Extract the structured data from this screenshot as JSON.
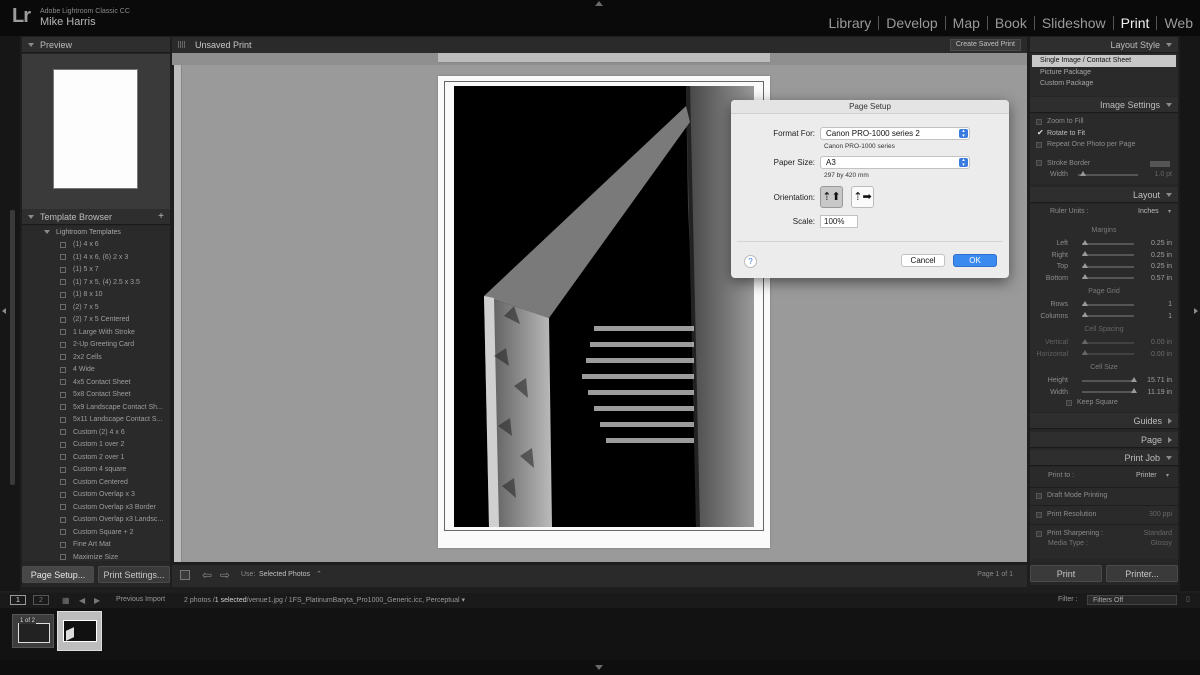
{
  "app": {
    "logo": "Lr",
    "name": "Adobe Lightroom Classic CC",
    "user": "Mike Harris"
  },
  "modules": [
    "Library",
    "Develop",
    "Map",
    "Book",
    "Slideshow",
    "Print",
    "Web"
  ],
  "active_module": "Print",
  "left_panel": {
    "preview_title": "Preview",
    "template_browser_title": "Template Browser",
    "template_browser_add": "+",
    "folder": "Lightroom Templates",
    "templates": [
      "(1) 4 x 6",
      "(1) 4 x 6, (6) 2 x 3",
      "(1) 5 x 7",
      "(1) 7 x 5, (4) 2.5 x 3.5",
      "(1) 8 x 10",
      "(2) 7 x 5",
      "(2) 7 x 5 Centered",
      "1 Large With Stroke",
      "2-Up Greeting Card",
      "2x2 Cells",
      "4 Wide",
      "4x5 Contact Sheet",
      "5x8 Contact Sheet",
      "5x9 Landscape Contact Sh...",
      "5x11 Landscape Contact S...",
      "Custom (2) 4 x 6",
      "Custom 1 over 2",
      "Custom 2 over 1",
      "Custom 4 square",
      "Custom Centered",
      "Custom Overlap x 3",
      "Custom Overlap x3 Border",
      "Custom Overlap x3 Landsc...",
      "Custom Square + 2",
      "Fine Art Mat",
      "Maximize Size"
    ],
    "page_setup_btn": "Page Setup...",
    "print_settings_btn": "Print Settings..."
  },
  "main": {
    "title": "Unsaved Print",
    "create_saved_print": "Create Saved Print",
    "use_label": "Use:",
    "use_value": "Selected Photos",
    "page_indicator": "Page 1 of 1"
  },
  "right_panel": {
    "layout_style_title": "Layout Style",
    "layout_styles": [
      "Single Image / Contact Sheet",
      "Picture Package",
      "Custom Package"
    ],
    "image_settings_title": "Image Settings",
    "zoom_to_fill": "Zoom to Fill",
    "rotate_to_fit": "Rotate to Fit",
    "repeat_one": "Repeat One Photo per Page",
    "stroke_border": "Stroke Border",
    "width_label": "Width",
    "width_value": "1.0 pt",
    "layout_title": "Layout",
    "ruler_units_label": "Ruler Units :",
    "ruler_units_value": "Inches",
    "margins_label": "Margins",
    "margins": [
      {
        "label": "Left",
        "value": "0.25 in"
      },
      {
        "label": "Right",
        "value": "0.25 in"
      },
      {
        "label": "Top",
        "value": "0.25 in"
      },
      {
        "label": "Bottom",
        "value": "0.57 in"
      }
    ],
    "page_grid_label": "Page Grid",
    "grid": [
      {
        "label": "Rows",
        "value": "1"
      },
      {
        "label": "Columns",
        "value": "1"
      }
    ],
    "cell_spacing_label": "Cell Spacing",
    "spacing": [
      {
        "label": "Vertical",
        "value": "0.00 in"
      },
      {
        "label": "Horizontal",
        "value": "0.00 in"
      }
    ],
    "cell_size_label": "Cell Size",
    "cell_size": [
      {
        "label": "Height",
        "value": "15.71 in"
      },
      {
        "label": "Width",
        "value": "11.19 in"
      }
    ],
    "keep_square": "Keep Square",
    "guides_title": "Guides",
    "page_title": "Page",
    "print_job_title": "Print Job",
    "print_to_label": "Print to :",
    "print_to_value": "Printer",
    "draft_mode": "Draft Mode Printing",
    "print_resolution": "Print Resolution",
    "print_resolution_value": "300 ppi",
    "print_sharpening": "Print Sharpening :",
    "print_sharpening_value": "Standard",
    "media_type": "Media Type :",
    "media_type_value": "Glossy",
    "print_btn": "Print",
    "printer_btn": "Printer..."
  },
  "filmstrip": {
    "view1": "1",
    "view2": "2",
    "source": "Previous Import",
    "info_count": "2 photos /",
    "info_selected": "1 selected",
    "info_rest": "/venue1.jpg / 1FS_PlatinumBaryta_Pro1000_Generic.icc, Perceptual",
    "filter_label": "Filter :",
    "filter_value": "Filters Off",
    "thumb_badge": "1 of 2"
  },
  "dialog": {
    "title": "Page Setup",
    "format_for_label": "Format For:",
    "format_for_value": "Canon PRO-1000 series 2",
    "format_for_sub": "Canon PRO-1000 series",
    "paper_size_label": "Paper Size:",
    "paper_size_value": "A3",
    "paper_size_sub": "297 by 420 mm",
    "orientation_label": "Orientation:",
    "scale_label": "Scale:",
    "scale_value": "100%",
    "help": "?",
    "cancel": "Cancel",
    "ok": "OK"
  },
  "colors": {
    "accent": "#3a7be0",
    "panel_bg": "#262626",
    "canvas": "#9a9a9a"
  }
}
